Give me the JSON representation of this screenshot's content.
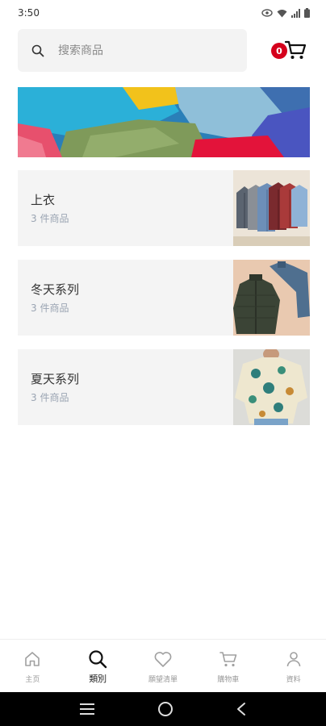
{
  "status_bar": {
    "time": "3:50"
  },
  "search": {
    "placeholder": "搜索商品"
  },
  "cart": {
    "badge_count": "0"
  },
  "categories": [
    {
      "title": "上衣",
      "count": "3 件商品"
    },
    {
      "title": "冬天系列",
      "count": "3 件商品"
    },
    {
      "title": "夏天系列",
      "count": "3 件商品"
    }
  ],
  "bottom_nav": [
    {
      "label": "主页",
      "icon": "home-icon",
      "active": false
    },
    {
      "label": "類別",
      "icon": "search-icon",
      "active": true
    },
    {
      "label": "願望清單",
      "icon": "heart-icon",
      "active": false
    },
    {
      "label": "購物車",
      "icon": "cart-icon",
      "active": false
    },
    {
      "label": "資料",
      "icon": "person-icon",
      "active": false
    }
  ],
  "colors": {
    "badge": "#d5001c",
    "card_background": "#f4f4f4",
    "count_text": "#9aa4b2"
  }
}
